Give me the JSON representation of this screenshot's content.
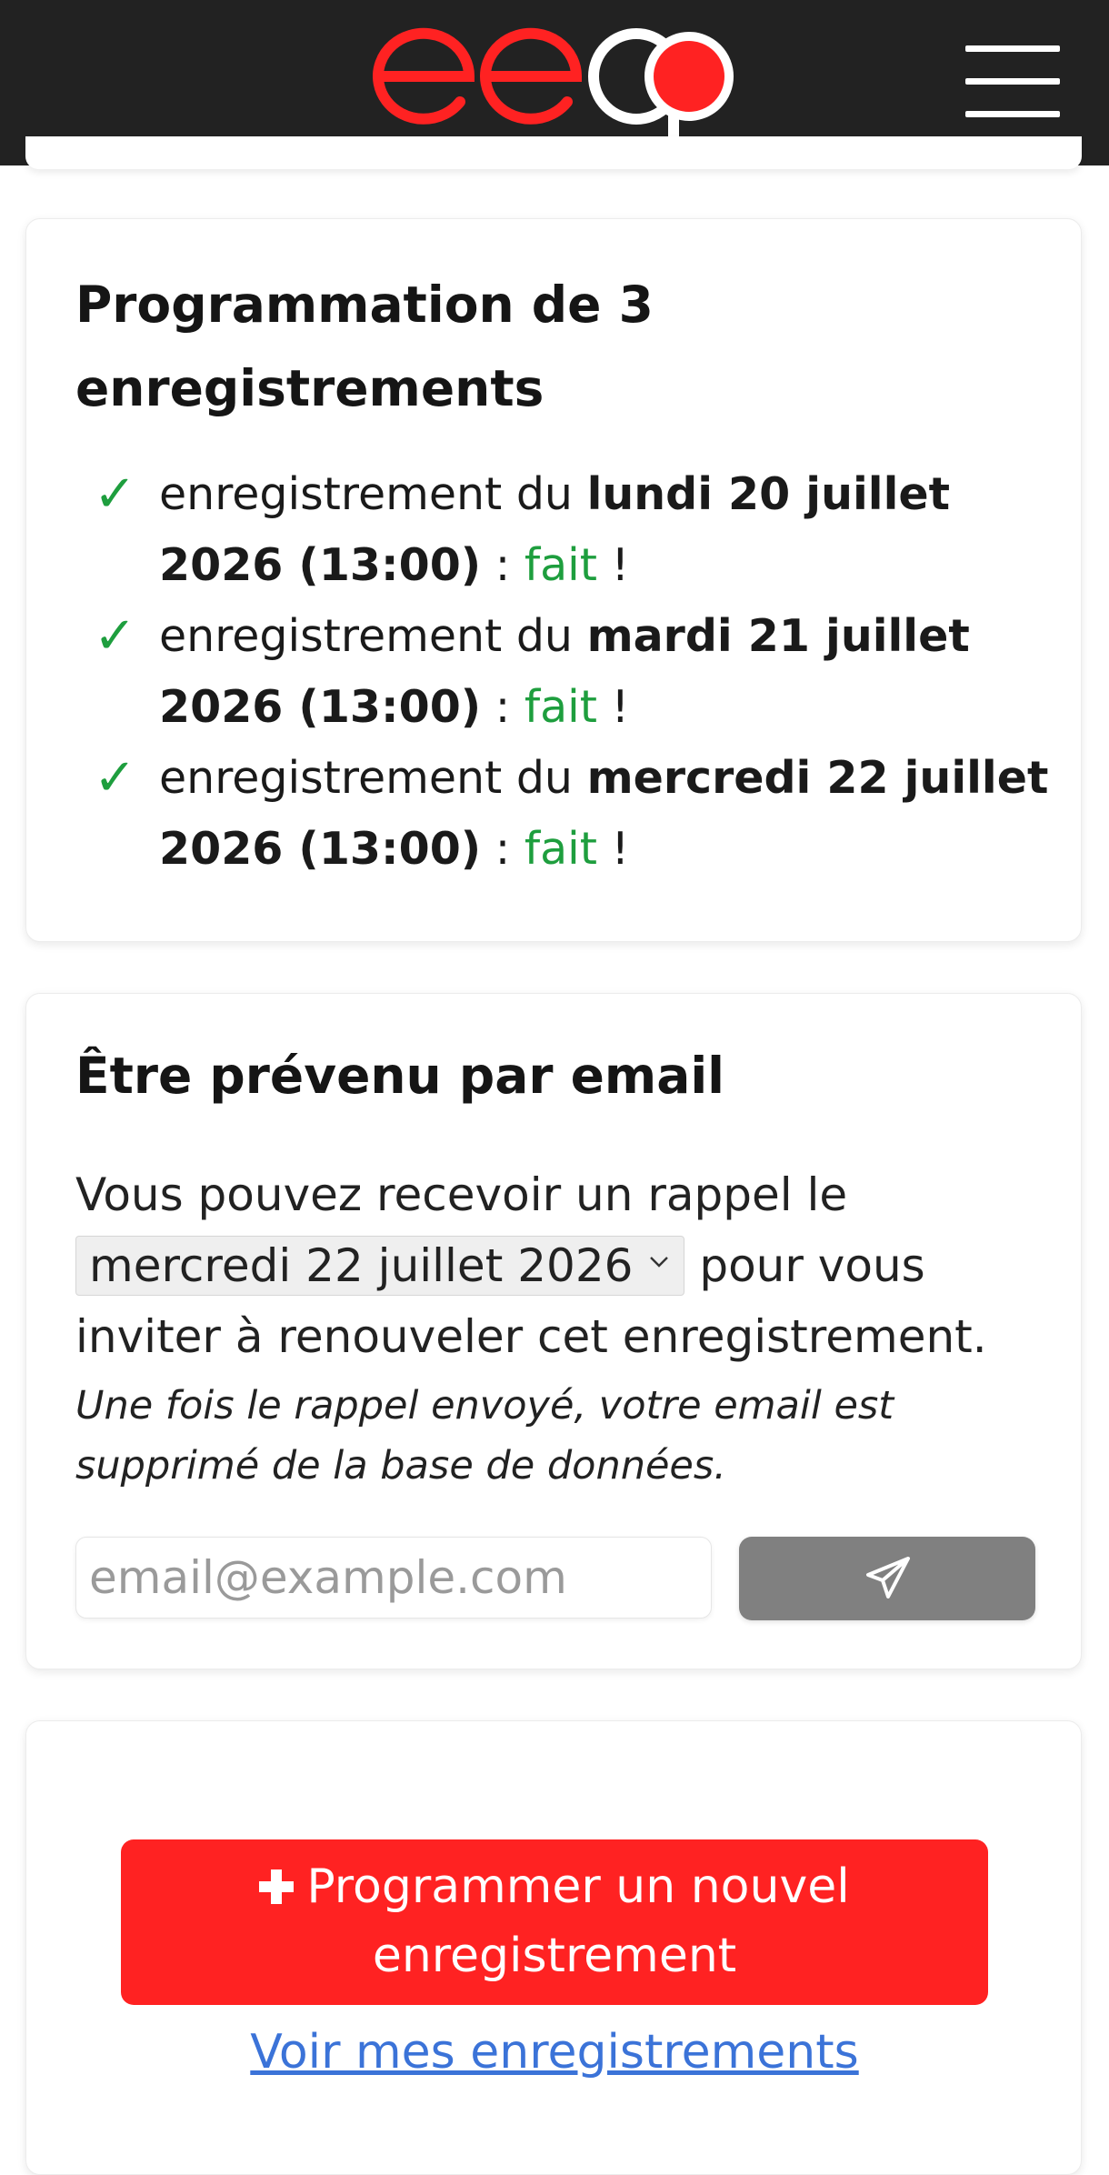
{
  "header": {
    "logo_text": "eeqo",
    "menu_icon": "hamburger-menu-icon",
    "colors": {
      "background": "#222222",
      "logo_red": "#ff2222",
      "logo_white": "#ffffff"
    }
  },
  "schedule_card": {
    "title": "Programmation de 3 enregistrements",
    "check_icon": "checkmark-icon",
    "items": [
      {
        "prefix": "enregistrement du ",
        "date": "lundi 20 juillet 2026 (13:00)",
        "separator": " : ",
        "status": "fait",
        "suffix": " !"
      },
      {
        "prefix": "enregistrement du ",
        "date": "mardi 21 juillet 2026 (13:00)",
        "separator": " : ",
        "status": "fait",
        "suffix": " !"
      },
      {
        "prefix": "enregistrement du ",
        "date": "mercredi 22 juillet 2026 (13:00)",
        "separator": " : ",
        "status": "fait",
        "suffix": " !"
      }
    ]
  },
  "email_card": {
    "title": "Être prévenu par email",
    "text_before": "Vous pouvez recevoir un rappel le ",
    "selected_date": "mercredi 22 juillet 2026",
    "text_after": " pour vous inviter à renouveler cet enregistrement.",
    "note": "Une fois le rappel envoyé, votre email est supprimé de la base de données.",
    "email_placeholder": "email@example.com",
    "send_icon": "paper-plane-icon"
  },
  "actions_card": {
    "new_button_label": "Programmer un nouvel enregistrement",
    "plus_icon": "plus-icon",
    "view_link_label": "Voir mes enregistrements"
  },
  "colors": {
    "accent_red": "#ff2222",
    "success_green": "#1e9e3e",
    "link_blue": "#3b73d8",
    "send_gray": "#808080"
  }
}
